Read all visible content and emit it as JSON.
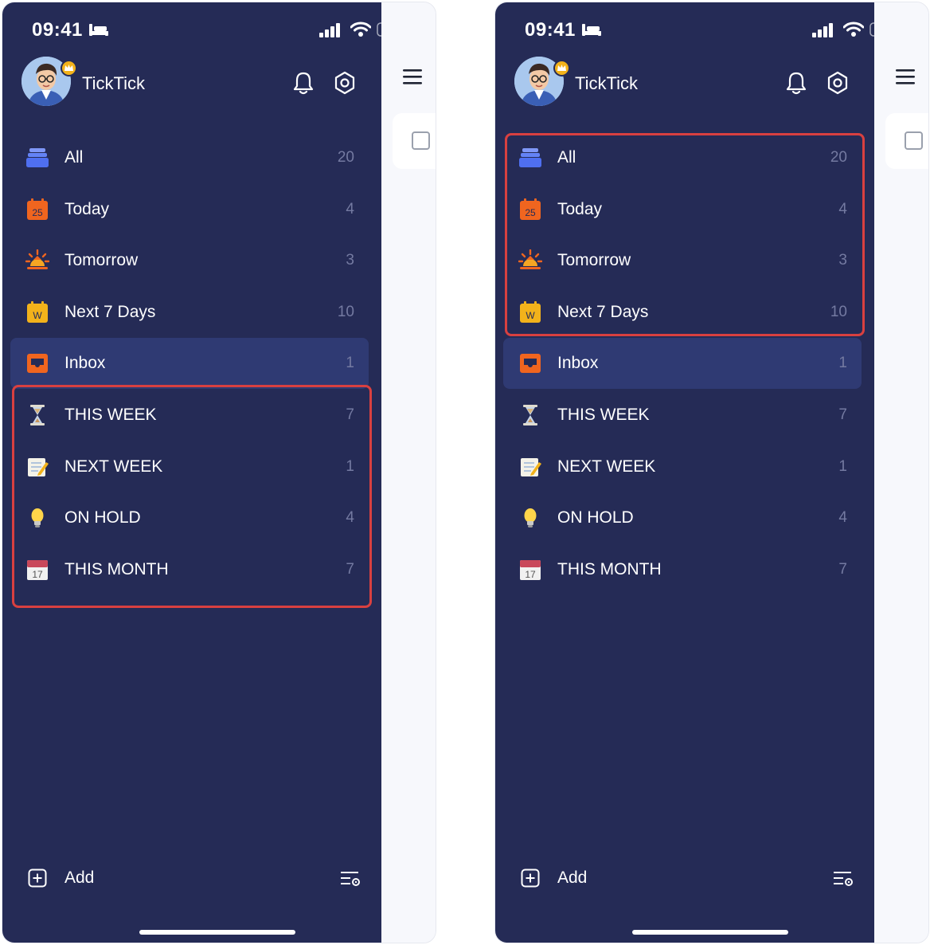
{
  "screens": [
    {
      "status_time": "09:41",
      "app_name": "TickTick",
      "smart_lists": [
        {
          "label": "All",
          "count": "20",
          "icon": "stack-icon"
        },
        {
          "label": "Today",
          "count": "4",
          "icon": "calendar-today-icon",
          "badge": "25"
        },
        {
          "label": "Tomorrow",
          "count": "3",
          "icon": "sunrise-icon"
        },
        {
          "label": "Next 7 Days",
          "count": "10",
          "icon": "calendar-week-icon",
          "badge": "W"
        }
      ],
      "inbox": {
        "label": "Inbox",
        "count": "1",
        "icon": "inbox-icon"
      },
      "lists": [
        {
          "label": "THIS WEEK",
          "count": "7",
          "icon": "hourglass-icon"
        },
        {
          "label": "NEXT WEEK",
          "count": "1",
          "icon": "memo-icon"
        },
        {
          "label": "ON HOLD",
          "count": "4",
          "icon": "lightbulb-icon"
        },
        {
          "label": "THIS MONTH",
          "count": "7",
          "icon": "calendar-icon",
          "badge": "17"
        }
      ],
      "footer": {
        "add_label": "Add"
      },
      "highlighted_group": "lists"
    },
    {
      "status_time": "09:41",
      "app_name": "TickTick",
      "smart_lists": [
        {
          "label": "All",
          "count": "20",
          "icon": "stack-icon"
        },
        {
          "label": "Today",
          "count": "4",
          "icon": "calendar-today-icon",
          "badge": "25"
        },
        {
          "label": "Tomorrow",
          "count": "3",
          "icon": "sunrise-icon"
        },
        {
          "label": "Next 7 Days",
          "count": "10",
          "icon": "calendar-week-icon",
          "badge": "W"
        }
      ],
      "inbox": {
        "label": "Inbox",
        "count": "1",
        "icon": "inbox-icon"
      },
      "lists": [
        {
          "label": "THIS WEEK",
          "count": "7",
          "icon": "hourglass-icon"
        },
        {
          "label": "NEXT WEEK",
          "count": "1",
          "icon": "memo-icon"
        },
        {
          "label": "ON HOLD",
          "count": "4",
          "icon": "lightbulb-icon"
        },
        {
          "label": "THIS MONTH",
          "count": "7",
          "icon": "calendar-icon",
          "badge": "17"
        }
      ],
      "footer": {
        "add_label": "Add"
      },
      "highlighted_group": "smart_lists"
    }
  ],
  "colors": {
    "drawer_bg": "#252b56",
    "selected_row_bg": "#2f3a73",
    "count_text": "#747aa1",
    "highlight_border": "#d94040",
    "accent_orange": "#f0651f",
    "accent_blue": "#4f6ff0",
    "accent_yellow": "#f2b21b"
  }
}
